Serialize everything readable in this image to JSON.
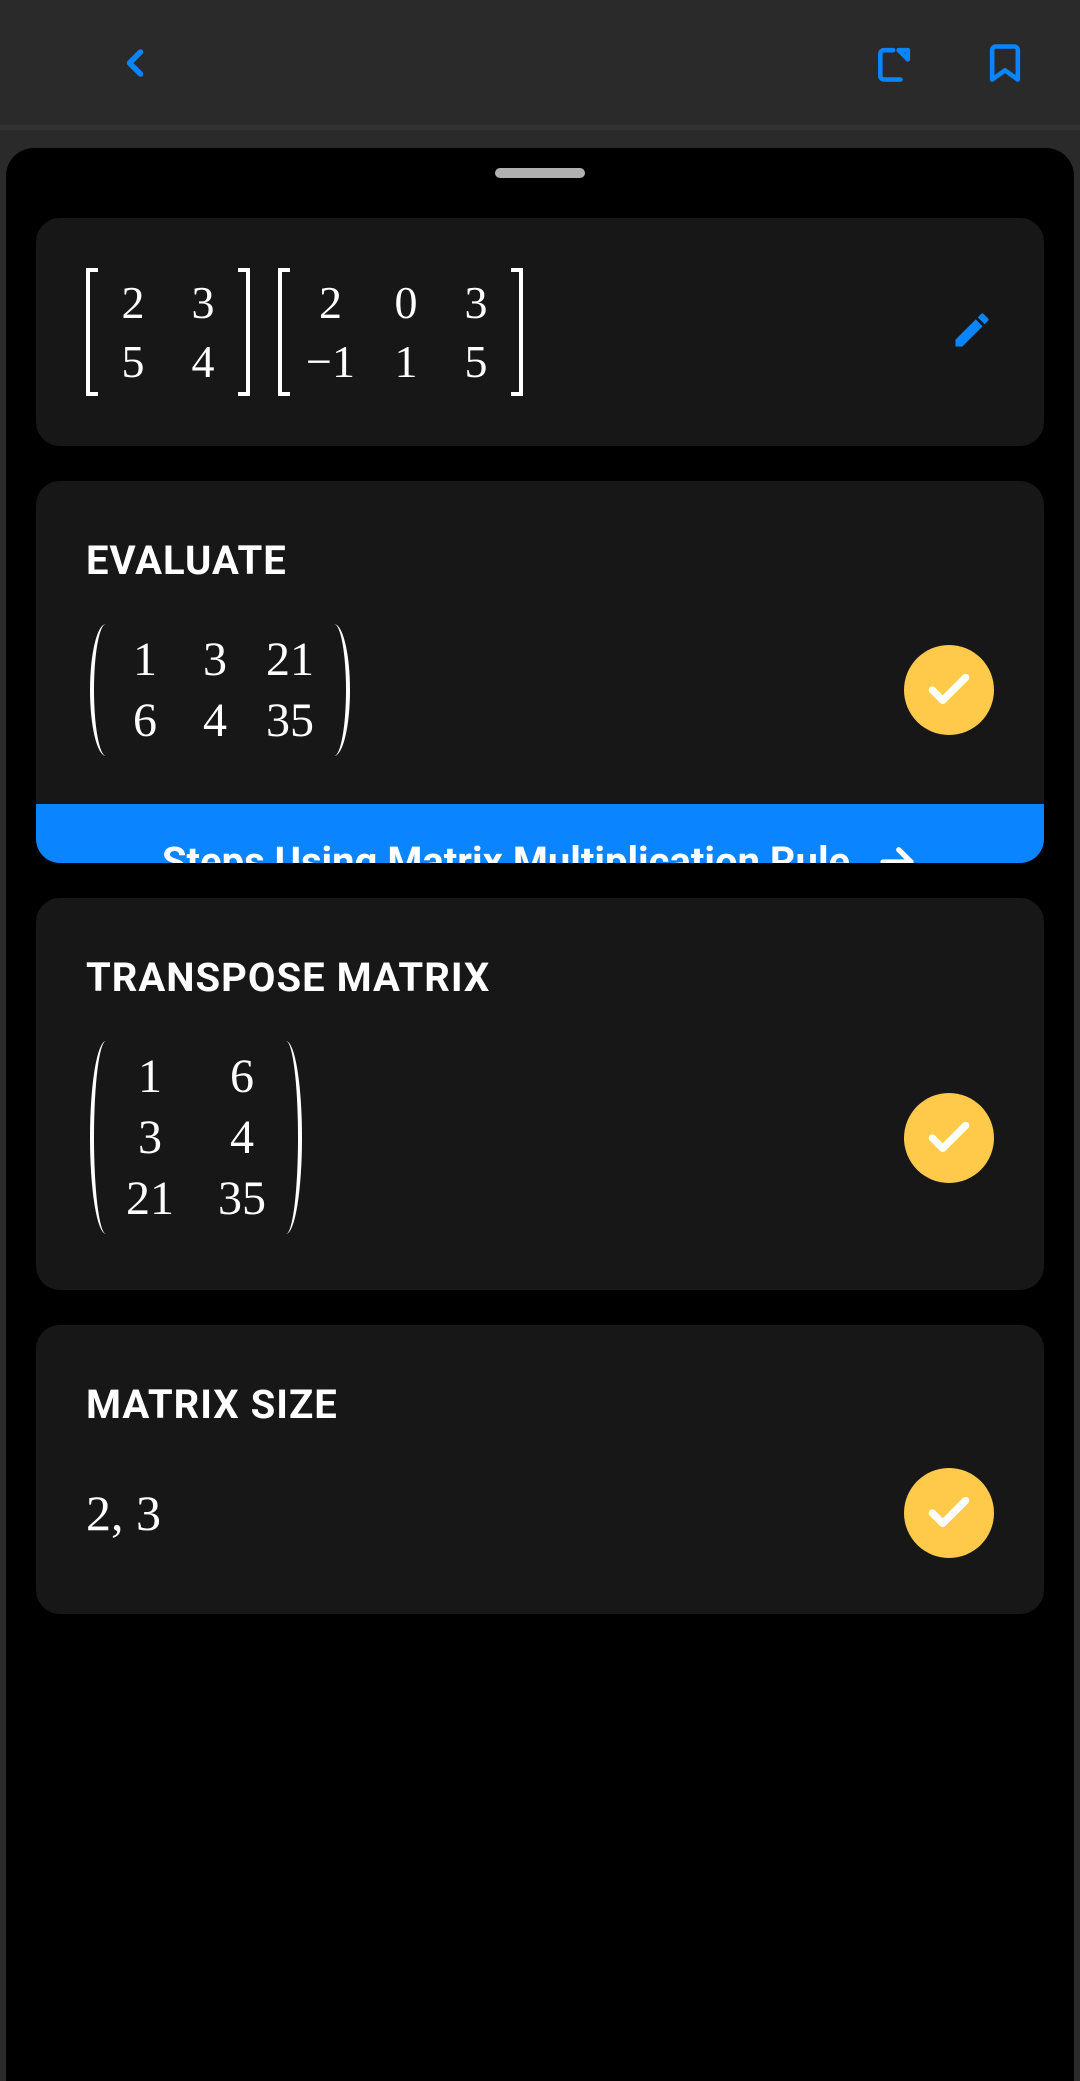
{
  "colors": {
    "accent": "#0a84ff",
    "badge": "#ffc94a",
    "cardBg": "#171717",
    "sheetBg": "#000000"
  },
  "icons": {
    "back": "chevron-left-icon",
    "share": "share-icon",
    "bookmark": "bookmark-icon",
    "edit": "pencil-icon",
    "check": "check-icon",
    "arrow": "arrow-right-icon"
  },
  "input": {
    "matrices": [
      {
        "rows": 2,
        "cols": 2,
        "data": [
          [
            "2",
            "3"
          ],
          [
            "5",
            "4"
          ]
        ]
      },
      {
        "rows": 2,
        "cols": 3,
        "data": [
          [
            "2",
            "0",
            "3"
          ],
          [
            "−1",
            "1",
            "5"
          ]
        ]
      }
    ]
  },
  "sections": [
    {
      "key": "evaluate",
      "title": "EVALUATE",
      "type": "pmatrix",
      "matrix": {
        "rows": 2,
        "cols": 3,
        "data": [
          [
            "1",
            "3",
            "21"
          ],
          [
            "6",
            "4",
            "35"
          ]
        ]
      },
      "steps_label": "Steps Using Matrix Multiplication Rule"
    },
    {
      "key": "transpose",
      "title": "TRANSPOSE MATRIX",
      "type": "pmatrix",
      "matrix": {
        "rows": 3,
        "cols": 2,
        "data": [
          [
            "1",
            "6"
          ],
          [
            "3",
            "4"
          ],
          [
            "21",
            "35"
          ]
        ]
      }
    },
    {
      "key": "size",
      "title": "MATRIX SIZE",
      "type": "scalar",
      "value": "2, 3"
    }
  ]
}
